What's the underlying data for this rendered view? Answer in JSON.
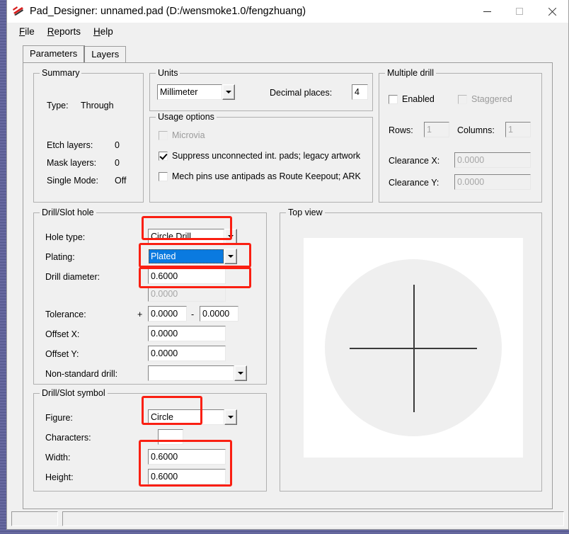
{
  "window": {
    "title": "Pad_Designer: unnamed.pad (D:/wensmoke1.0/fengzhuang)",
    "app_icon": "pad-designer-icon",
    "controls": {
      "minimize": "minimize-icon",
      "maximize": "maximize-icon",
      "close": "close-icon"
    }
  },
  "menubar": {
    "items": [
      {
        "label": "File",
        "mnemonic": "F"
      },
      {
        "label": "Reports",
        "mnemonic": "R"
      },
      {
        "label": "Help",
        "mnemonic": "H"
      }
    ]
  },
  "tabs": [
    {
      "label": "Parameters",
      "active": true
    },
    {
      "label": "Layers",
      "active": false
    }
  ],
  "summary": {
    "legend": "Summary",
    "rows": [
      {
        "label": "Type:",
        "value": "Through"
      },
      {
        "label": "Etch layers:",
        "value": "0"
      },
      {
        "label": "Mask layers:",
        "value": "0"
      },
      {
        "label": "Single Mode:",
        "value": "Off"
      }
    ]
  },
  "units": {
    "legend": "Units",
    "unit_value": "Millimeter",
    "decimal_label": "Decimal places:",
    "decimal_value": "4"
  },
  "usage_options": {
    "legend": "Usage options",
    "items": [
      {
        "label": "Microvia",
        "checked": false,
        "disabled": true
      },
      {
        "label": "Suppress unconnected int. pads; legacy artwork",
        "checked": true,
        "disabled": false
      },
      {
        "label": "Mech pins use antipads as Route Keepout; ARK",
        "checked": false,
        "disabled": false
      }
    ]
  },
  "multiple_drill": {
    "legend": "Multiple drill",
    "enabled_label": "Enabled",
    "enabled_checked": false,
    "staggered_label": "Staggered",
    "staggered_checked": false,
    "staggered_disabled": true,
    "rows_label": "Rows:",
    "rows_value": "1",
    "columns_label": "Columns:",
    "columns_value": "1",
    "clearance_x_label": "Clearance X:",
    "clearance_x_value": "0.0000",
    "clearance_y_label": "Clearance Y:",
    "clearance_y_value": "0.0000"
  },
  "drill_slot_hole": {
    "legend": "Drill/Slot hole",
    "hole_type_label": "Hole type:",
    "hole_type_value": "Circle Drill",
    "plating_label": "Plating:",
    "plating_value": "Plated",
    "drill_diameter_label": "Drill diameter:",
    "drill_diameter_value": "0.6000",
    "drill_diameter_second_value": "0.0000",
    "tolerance_label": "Tolerance:",
    "tolerance_plus_sign": "+",
    "tolerance_plus_value": "0.0000",
    "tolerance_dash": "-",
    "tolerance_minus_value": "0.0000",
    "offset_x_label": "Offset X:",
    "offset_x_value": "0.0000",
    "offset_y_label": "Offset Y:",
    "offset_y_value": "0.0000",
    "non_standard_label": "Non-standard drill:",
    "non_standard_value": ""
  },
  "drill_slot_symbol": {
    "legend": "Drill/Slot symbol",
    "figure_label": "Figure:",
    "figure_value": "Circle",
    "characters_label": "Characters:",
    "characters_value": "",
    "width_label": "Width:",
    "width_value": "0.6000",
    "height_label": "Height:",
    "height_value": "0.6000"
  },
  "top_view": {
    "legend": "Top view",
    "canvas_bg": "#ffffff",
    "pad_color": "#efefef",
    "crosshair_color": "#3a3a3a"
  },
  "statusbar": {
    "left_text": "",
    "right_text": ""
  },
  "annotations": {
    "highlight_color": "#fa1f12",
    "boxes": [
      "hole-type-highlight",
      "plating-highlight",
      "drill-diameter-highlight",
      "figure-highlight",
      "width-height-highlight"
    ]
  }
}
